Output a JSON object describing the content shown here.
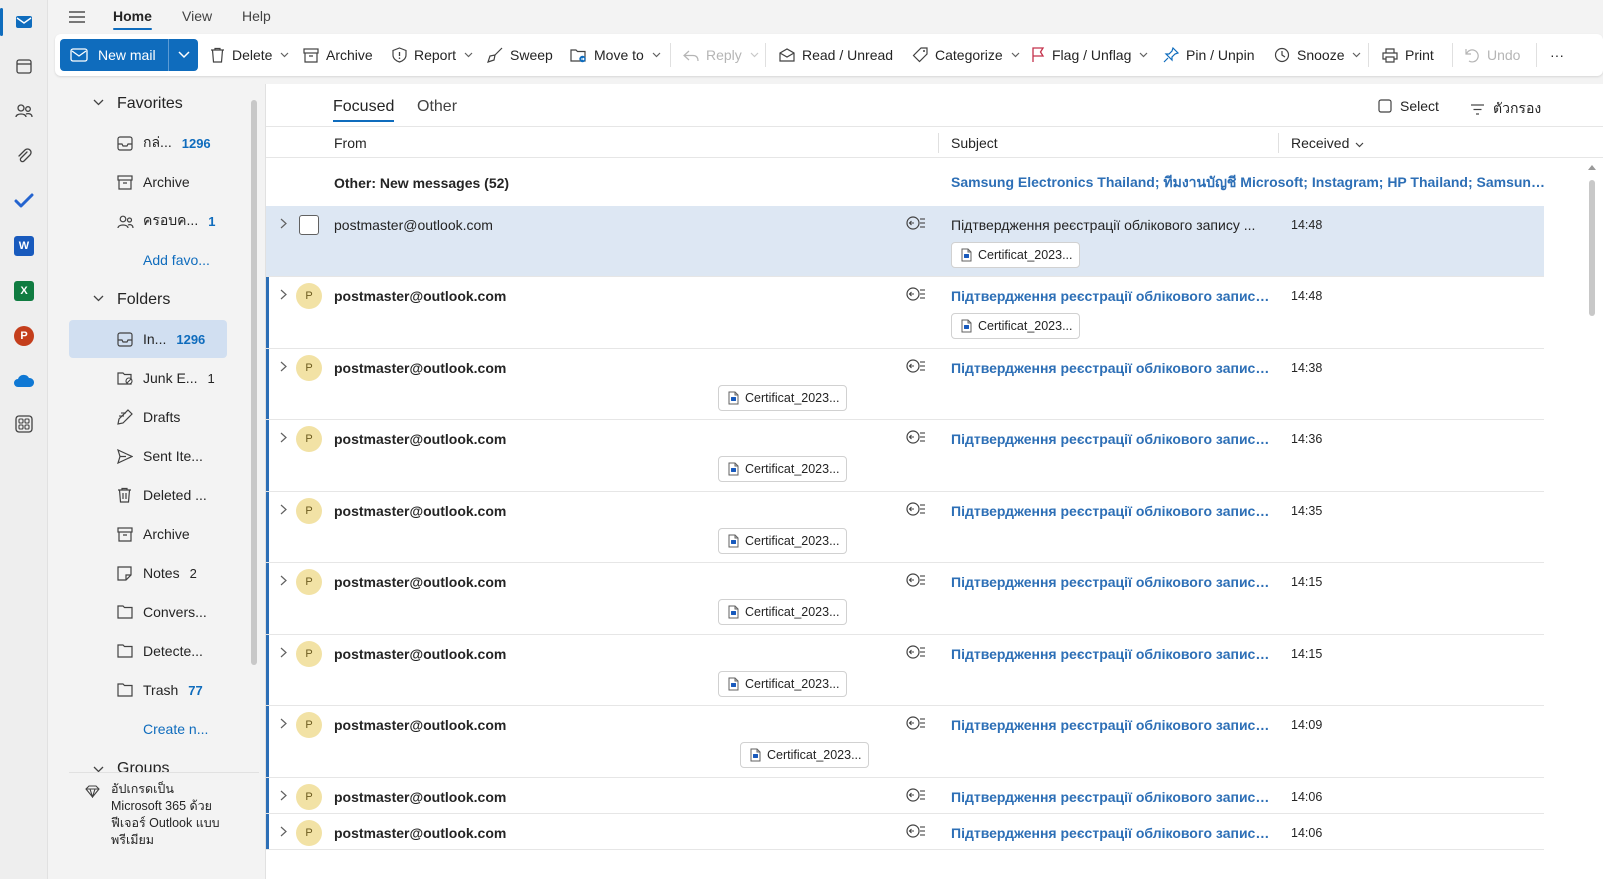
{
  "ribbon": {
    "tabs": [
      "Home",
      "View",
      "Help"
    ],
    "new_mail": "New mail",
    "delete": "Delete",
    "archive": "Archive",
    "report": "Report",
    "sweep": "Sweep",
    "move_to": "Move to",
    "reply": "Reply",
    "read_unread": "Read / Unread",
    "categorize": "Categorize",
    "flag": "Flag / Unflag",
    "pin": "Pin / Unpin",
    "snooze": "Snooze",
    "print": "Print",
    "undo": "Undo",
    "more": "···"
  },
  "folders": {
    "favorites_title": "Favorites",
    "favorites": [
      {
        "label": "กล่...",
        "count": "1296",
        "icon": "inbox-icon"
      },
      {
        "label": "Archive",
        "count": "",
        "icon": "archive-icon"
      },
      {
        "label": "ครอบค...",
        "count": "1",
        "icon": "people-icon"
      }
    ],
    "add_favorite": "Add favo...",
    "folders_title": "Folders",
    "items": [
      {
        "label": "In...",
        "count": "1296",
        "icon": "inbox-icon",
        "count_style": "blue"
      },
      {
        "label": "Junk E...",
        "count": "1",
        "icon": "junk-icon",
        "count_style": "plain"
      },
      {
        "label": "Drafts",
        "count": "",
        "icon": "drafts-icon",
        "count_style": "plain"
      },
      {
        "label": "Sent Ite...",
        "count": "",
        "icon": "sent-icon",
        "count_style": "plain"
      },
      {
        "label": "Deleted ...",
        "count": "",
        "icon": "trash-icon",
        "count_style": "plain"
      },
      {
        "label": "Archive",
        "count": "",
        "icon": "archive-icon",
        "count_style": "plain"
      },
      {
        "label": "Notes",
        "count": "2",
        "icon": "notes-icon",
        "count_style": "plain"
      },
      {
        "label": "Convers...",
        "count": "",
        "icon": "folder-icon",
        "count_style": "plain"
      },
      {
        "label": "Detecte...",
        "count": "",
        "icon": "folder-icon",
        "count_style": "plain"
      },
      {
        "label": "Trash",
        "count": "77",
        "icon": "folder-icon",
        "count_style": "blue"
      }
    ],
    "create_new": "Create n...",
    "groups_title": "Groups",
    "upgrade_text": [
      "อัปเกรดเป็น",
      "Microsoft 365 ด้วย",
      "ฟีเจอร์ Outlook แบบ",
      "พรีเมียม"
    ]
  },
  "list": {
    "tab_focused": "Focused",
    "tab_other": "Other",
    "select": "Select",
    "filter": "ตัวกรอง",
    "col_from": "From",
    "col_subject": "Subject",
    "col_received": "Received",
    "other_banner": "Other: New messages (52)",
    "other_senders": "Samsung Electronics Thailand; ทีมงานบัญชี Microsoft; Instagram; HP Thailand; Samsung ...",
    "messages": [
      {
        "from": "postmaster@outlook.com",
        "subject": "Підтвердження реєстрації облікового запису ...",
        "time": "14:48",
        "attachment": "Certificat_2023...",
        "unread": false,
        "selected": true
      },
      {
        "from": "postmaster@outlook.com",
        "subject": "Підтвердження реєстрації облікового запису ...",
        "time": "14:48",
        "attachment": "Certificat_2023...",
        "unread": true,
        "selected": false
      },
      {
        "from": "postmaster@outlook.com",
        "subject": "Підтвердження реєстрації облікового запису ...",
        "time": "14:38",
        "attachment": "Certificat_2023...",
        "unread": true,
        "selected": false
      },
      {
        "from": "postmaster@outlook.com",
        "subject": "Підтвердження реєстрації облікового запису ...",
        "time": "14:36",
        "attachment": "Certificat_2023...",
        "unread": true,
        "selected": false
      },
      {
        "from": "postmaster@outlook.com",
        "subject": "Підтвердження реєстрації облікового запису ...",
        "time": "14:35",
        "attachment": "Certificat_2023...",
        "unread": true,
        "selected": false
      },
      {
        "from": "postmaster@outlook.com",
        "subject": "Підтвердження реєстрації облікового запису ...",
        "time": "14:15",
        "attachment": "Certificat_2023...",
        "unread": true,
        "selected": false
      },
      {
        "from": "postmaster@outlook.com",
        "subject": "Підтвердження реєстрації облікового запису ...",
        "time": "14:15",
        "attachment": "Certificat_2023...",
        "unread": true,
        "selected": false
      },
      {
        "from": "postmaster@outlook.com",
        "subject": "Підтвердження реєстрації облікового запису ...",
        "time": "14:09",
        "attachment": "Certificat_2023...",
        "unread": true,
        "selected": false
      },
      {
        "from": "postmaster@outlook.com",
        "subject": "Підтвердження реєстрації облікового запису ...",
        "time": "14:06",
        "attachment": "",
        "unread": true,
        "selected": false
      },
      {
        "from": "postmaster@outlook.com",
        "subject": "Підтвердження реєстрації облікового запису ...",
        "time": "14:06",
        "attachment": "",
        "unread": true,
        "selected": false
      }
    ],
    "avatar_initial": "P"
  },
  "colors": {
    "accent": "#0f6cbd",
    "unread_blue": "#2d6fb6",
    "selected_row": "#dde7f3",
    "avatar": "#f2e2a5"
  }
}
